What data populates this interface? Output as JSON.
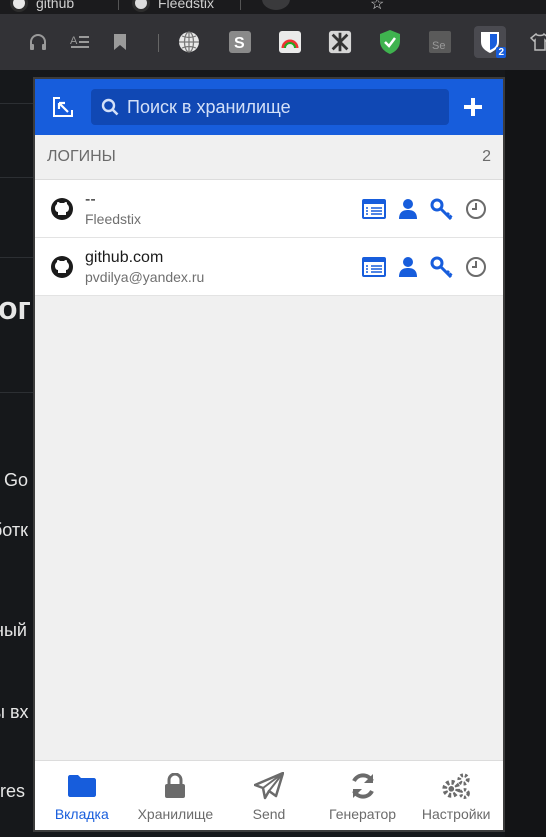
{
  "browser": {
    "tabs": [
      {
        "title": "github"
      },
      {
        "title": "Fleedstix"
      }
    ],
    "extension_badge": "2"
  },
  "background_page": {
    "fragments": [
      "ог",
      "s Go",
      "ботк",
      "ный",
      "ы вх",
      "ires"
    ]
  },
  "popup": {
    "search_placeholder": "Поиск в хранилище",
    "section": {
      "title": "ЛОГИНЫ",
      "count": "2"
    },
    "items": [
      {
        "name": "--",
        "username": "Fleedstix"
      },
      {
        "name": "github.com",
        "username": "pvdilya@yandex.ru"
      }
    ],
    "nav": [
      {
        "label": "Вкладка",
        "icon": "folder-icon",
        "active": true
      },
      {
        "label": "Хранилище",
        "icon": "lock-icon",
        "active": false
      },
      {
        "label": "Send",
        "icon": "paper-plane-icon",
        "active": false
      },
      {
        "label": "Генератор",
        "icon": "refresh-icon",
        "active": false
      },
      {
        "label": "Настройки",
        "icon": "cogs-icon",
        "active": false
      }
    ]
  },
  "colors": {
    "brand": "#175ddc",
    "active_nav": "#175ddc",
    "inactive_nav": "#6b6b6b"
  }
}
